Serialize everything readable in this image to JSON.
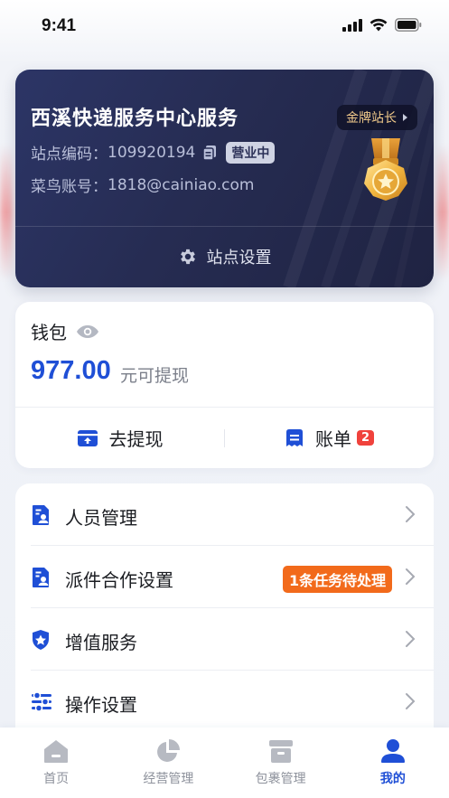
{
  "status_bar": {
    "time": "9:41",
    "icons": [
      "signal-icon",
      "wifi-icon",
      "battery-icon"
    ]
  },
  "station": {
    "name": "西溪快递服务中心服务",
    "code_label": "站点编码：",
    "code_value": "109920194",
    "status": "营业中",
    "account_label": "菜鸟账号：",
    "account_value": "1818@cainiao.com",
    "badge": "金牌站长",
    "settings_label": "站点设置"
  },
  "wallet": {
    "title": "钱包",
    "amount": "977.00",
    "unit": "元可提现",
    "withdraw_label": "去提现",
    "bill_label": "账单",
    "bill_count": "2"
  },
  "menu": {
    "items": [
      {
        "label": "人员管理",
        "icon": "staff-doc-icon"
      },
      {
        "label": "派件合作设置",
        "icon": "delivery-doc-icon",
        "badge": "1条任务待处理"
      },
      {
        "label": "增值服务",
        "icon": "shield-star-icon"
      },
      {
        "label": "操作设置",
        "icon": "sliders-icon"
      }
    ]
  },
  "tabs": [
    {
      "label": "首页",
      "icon": "home-icon",
      "active": false
    },
    {
      "label": "经营管理",
      "icon": "pie-chart-icon",
      "active": false
    },
    {
      "label": "包裹管理",
      "icon": "package-icon",
      "active": false
    },
    {
      "label": "我的",
      "icon": "user-icon",
      "active": true
    }
  ],
  "colors": {
    "accent": "#1f4fd6",
    "card_dark": "#262c52",
    "task_badge": "#f26a1b",
    "count_badge": "#f0423c",
    "gold": "#f0c98a"
  }
}
